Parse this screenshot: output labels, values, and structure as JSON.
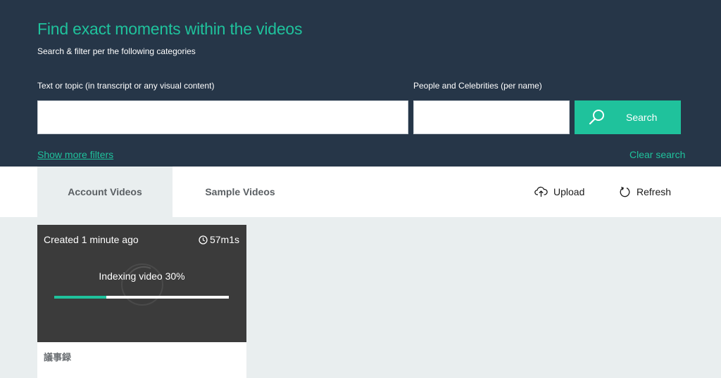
{
  "header": {
    "title": "Find exact moments within the videos",
    "subtitle": "Search & filter per the following categories",
    "text_label": "Text or topic (in transcript or any visual content)",
    "people_label": "People and Celebrities (per name)",
    "text_value": "",
    "people_value": "",
    "search_label": "Search",
    "search_icon": "search-icon",
    "show_more": "Show more filters",
    "clear": "Clear search"
  },
  "tabs": [
    {
      "label": "Account Videos",
      "active": true
    },
    {
      "label": "Sample Videos",
      "active": false
    }
  ],
  "actions": {
    "upload": "Upload",
    "upload_icon": "cloud-upload-icon",
    "refresh": "Refresh",
    "refresh_icon": "refresh-icon"
  },
  "video_card": {
    "created": "Created 1 minute ago",
    "duration": "57m1s",
    "duration_icon": "clock-icon",
    "status": "Indexing video 30%",
    "progress": 0.3,
    "name": "議事録"
  },
  "colors": {
    "header_bg": "#263648",
    "accent": "#1fc29c",
    "page_bg": "#e9eeef",
    "thumb_bg": "#3b3b3b"
  }
}
